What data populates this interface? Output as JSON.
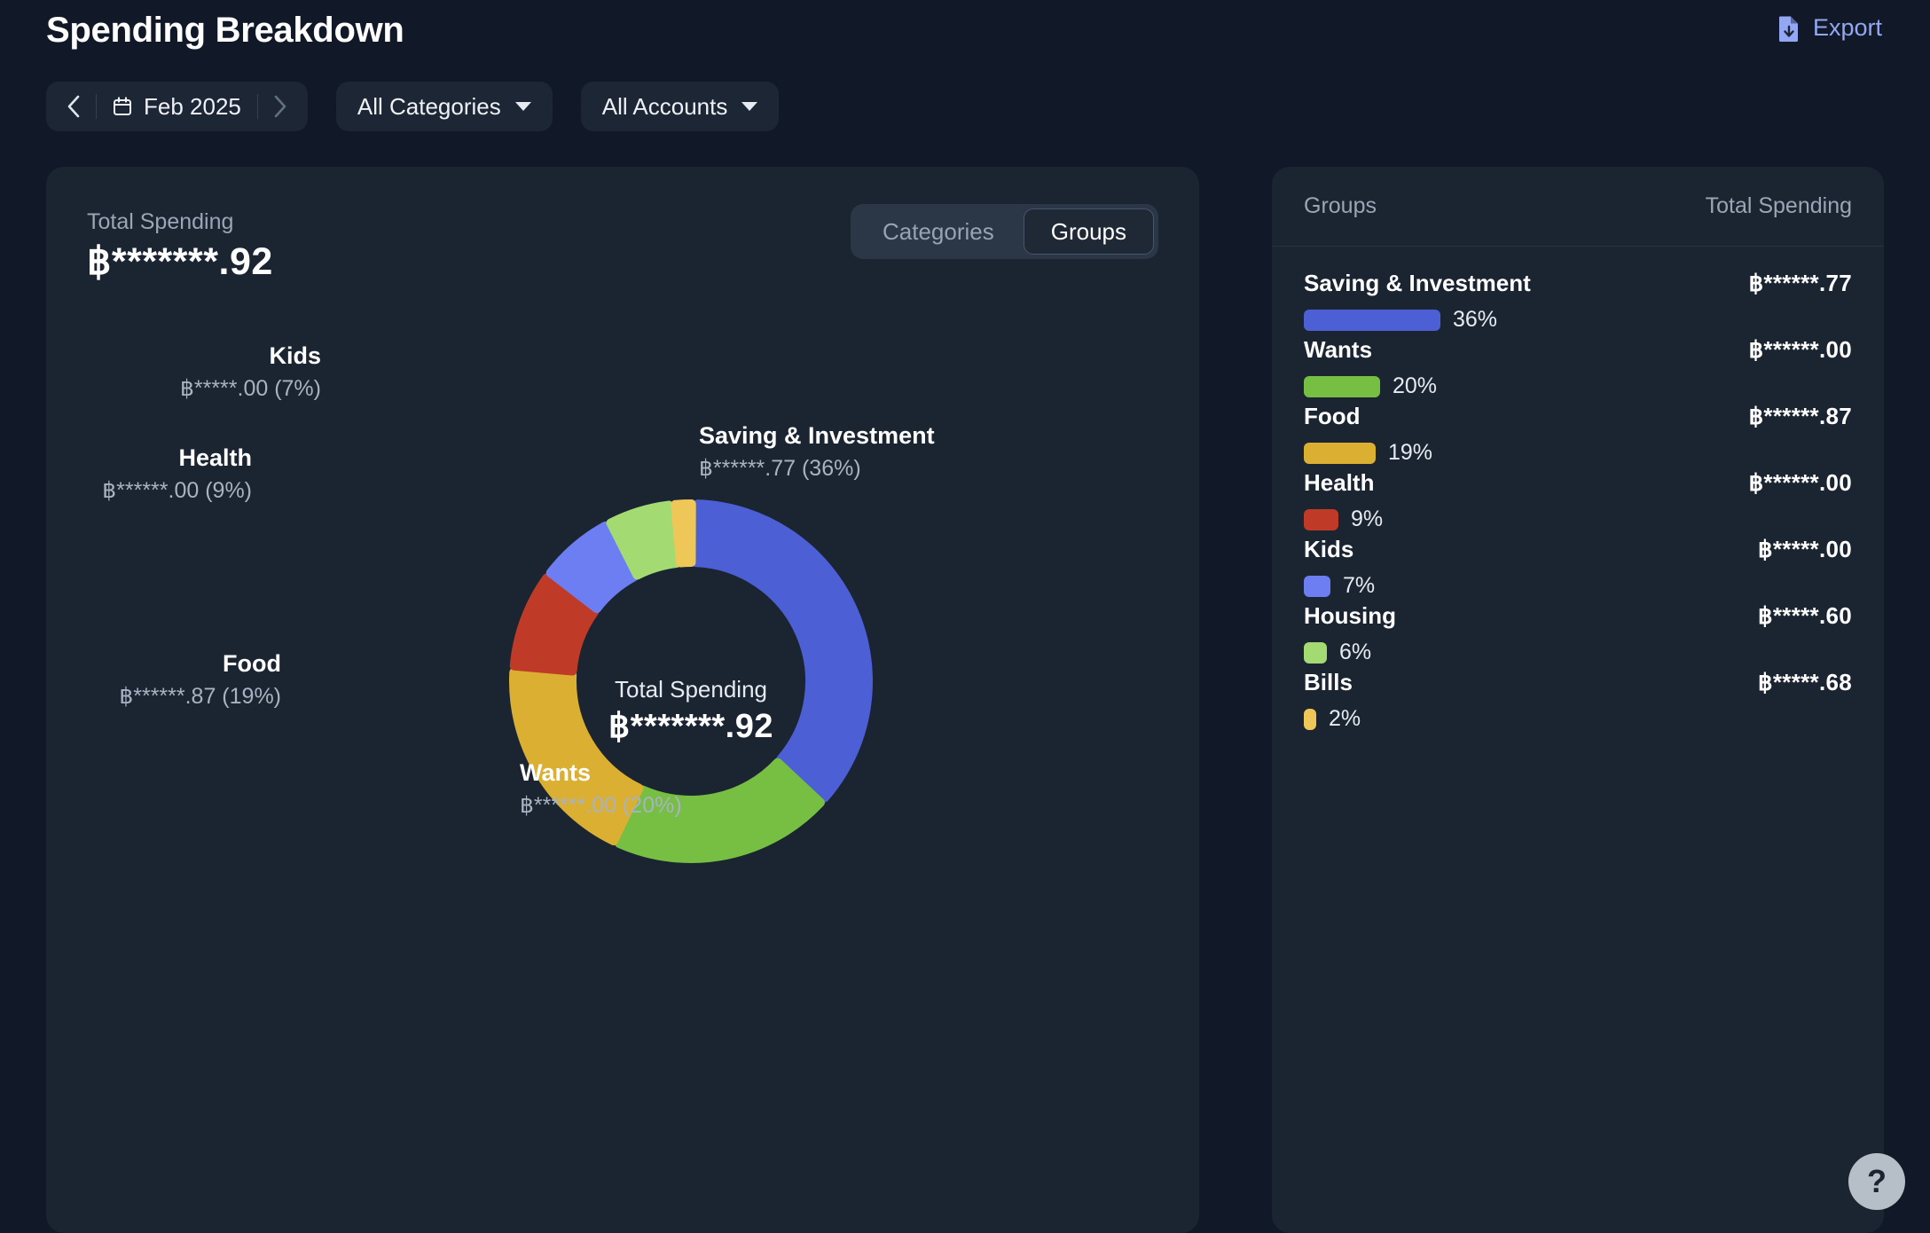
{
  "header": {
    "title": "Spending Breakdown",
    "export_label": "Export",
    "export_icon": "file-download-icon"
  },
  "toolbar": {
    "prev_icon": "chevron-left-icon",
    "next_icon": "chevron-right-icon",
    "calendar_icon": "calendar-icon",
    "period": "Feb 2025",
    "category_filter": "All Categories",
    "account_filter": "All Accounts",
    "caret_icon": "chevron-down-icon"
  },
  "summary": {
    "total_label": "Total Spending",
    "total_value": "฿*******.92"
  },
  "view_toggle": {
    "options": [
      "Categories",
      "Groups"
    ],
    "selected": "Groups"
  },
  "donut": {
    "center_label": "Total Spending",
    "center_value": "฿*******.92"
  },
  "right_panel": {
    "col_name": "Groups",
    "col_value": "Total Spending"
  },
  "help": {
    "label": "?",
    "icon": "question-mark-icon"
  },
  "colors": {
    "page_bg": "#111827",
    "card_bg": "#1b2431",
    "saving": "#4c5fd4",
    "wants": "#76bf43",
    "food": "#dbaf32",
    "health": "#c03a28",
    "kids": "#6d7df2",
    "housing": "#a3db72",
    "bills": "#efc758",
    "accent_link": "#93a7f2"
  },
  "chart_data": {
    "type": "pie",
    "title": "Spending Breakdown",
    "subtitle": "Total Spending ฿*******.92",
    "legend_position": "right",
    "categories": [
      "Saving & Investment",
      "Wants",
      "Food",
      "Health",
      "Kids",
      "Housing",
      "Bills"
    ],
    "values": [
      36,
      20,
      19,
      9,
      7,
      6,
      2
    ],
    "value_labels": [
      "฿******.77",
      "฿******.00",
      "฿******.87",
      "฿******.00",
      "฿*****.00",
      "฿*****.60",
      "฿*****.68"
    ],
    "percent_labels": [
      "36%",
      "20%",
      "19%",
      "9%",
      "7%",
      "6%",
      "2%"
    ],
    "colors": [
      "#4c5fd4",
      "#76bf43",
      "#dbaf32",
      "#c03a28",
      "#6d7df2",
      "#a3db72",
      "#efc758"
    ],
    "slices": [
      {
        "name": "Saving & Investment",
        "percent": 36,
        "amount": "฿******.77",
        "amount_with_pct": "฿******.77 (36%)",
        "color": "#4c5fd4"
      },
      {
        "name": "Wants",
        "percent": 20,
        "amount": "฿******.00",
        "amount_with_pct": "฿******.00 (20%)",
        "color": "#76bf43"
      },
      {
        "name": "Food",
        "percent": 19,
        "amount": "฿******.87",
        "amount_with_pct": "฿******.87 (19%)",
        "color": "#dbaf32"
      },
      {
        "name": "Health",
        "percent": 9,
        "amount": "฿******.00",
        "amount_with_pct": "฿******.00 (9%)",
        "color": "#c03a28"
      },
      {
        "name": "Kids",
        "percent": 7,
        "amount": "฿*****.00",
        "amount_with_pct": "฿*****.00 (7%)",
        "color": "#6d7df2"
      },
      {
        "name": "Housing",
        "percent": 6,
        "amount": "฿*****.60",
        "amount_with_pct": "฿*****.60 (6%)",
        "color": "#a3db72"
      },
      {
        "name": "Bills",
        "percent": 2,
        "amount": "฿*****.68",
        "amount_with_pct": "฿*****.68 (2%)",
        "color": "#efc758"
      }
    ]
  },
  "groups_table": {
    "rows": [
      {
        "name": "Saving & Investment",
        "amount": "฿******.77",
        "percent_label": "36%",
        "percent": 36,
        "color": "#4c5fd4"
      },
      {
        "name": "Wants",
        "amount": "฿******.00",
        "percent_label": "20%",
        "percent": 20,
        "color": "#76bf43"
      },
      {
        "name": "Food",
        "amount": "฿******.87",
        "percent_label": "19%",
        "percent": 19,
        "color": "#dbaf32"
      },
      {
        "name": "Health",
        "amount": "฿******.00",
        "percent_label": "9%",
        "percent": 9,
        "color": "#c03a28"
      },
      {
        "name": "Kids",
        "amount": "฿*****.00",
        "percent_label": "7%",
        "percent": 7,
        "color": "#6d7df2"
      },
      {
        "name": "Housing",
        "amount": "฿*****.60",
        "percent_label": "6%",
        "percent": 6,
        "color": "#a3db72"
      },
      {
        "name": "Bills",
        "amount": "฿*****.68",
        "percent_label": "2%",
        "percent": 2,
        "color": "#efc758"
      }
    ]
  },
  "chart_labels": [
    {
      "pos": "saving",
      "name": "Saving & Investment",
      "value": "฿******.77 (36%)"
    },
    {
      "pos": "wants",
      "name": "Wants",
      "value": "฿******.00 (20%)"
    },
    {
      "pos": "food",
      "name": "Food",
      "value": "฿******.87 (19%)"
    },
    {
      "pos": "health",
      "name": "Health",
      "value": "฿******.00 (9%)"
    },
    {
      "pos": "kids",
      "name": "Kids",
      "value": "฿*****.00 (7%)"
    }
  ]
}
